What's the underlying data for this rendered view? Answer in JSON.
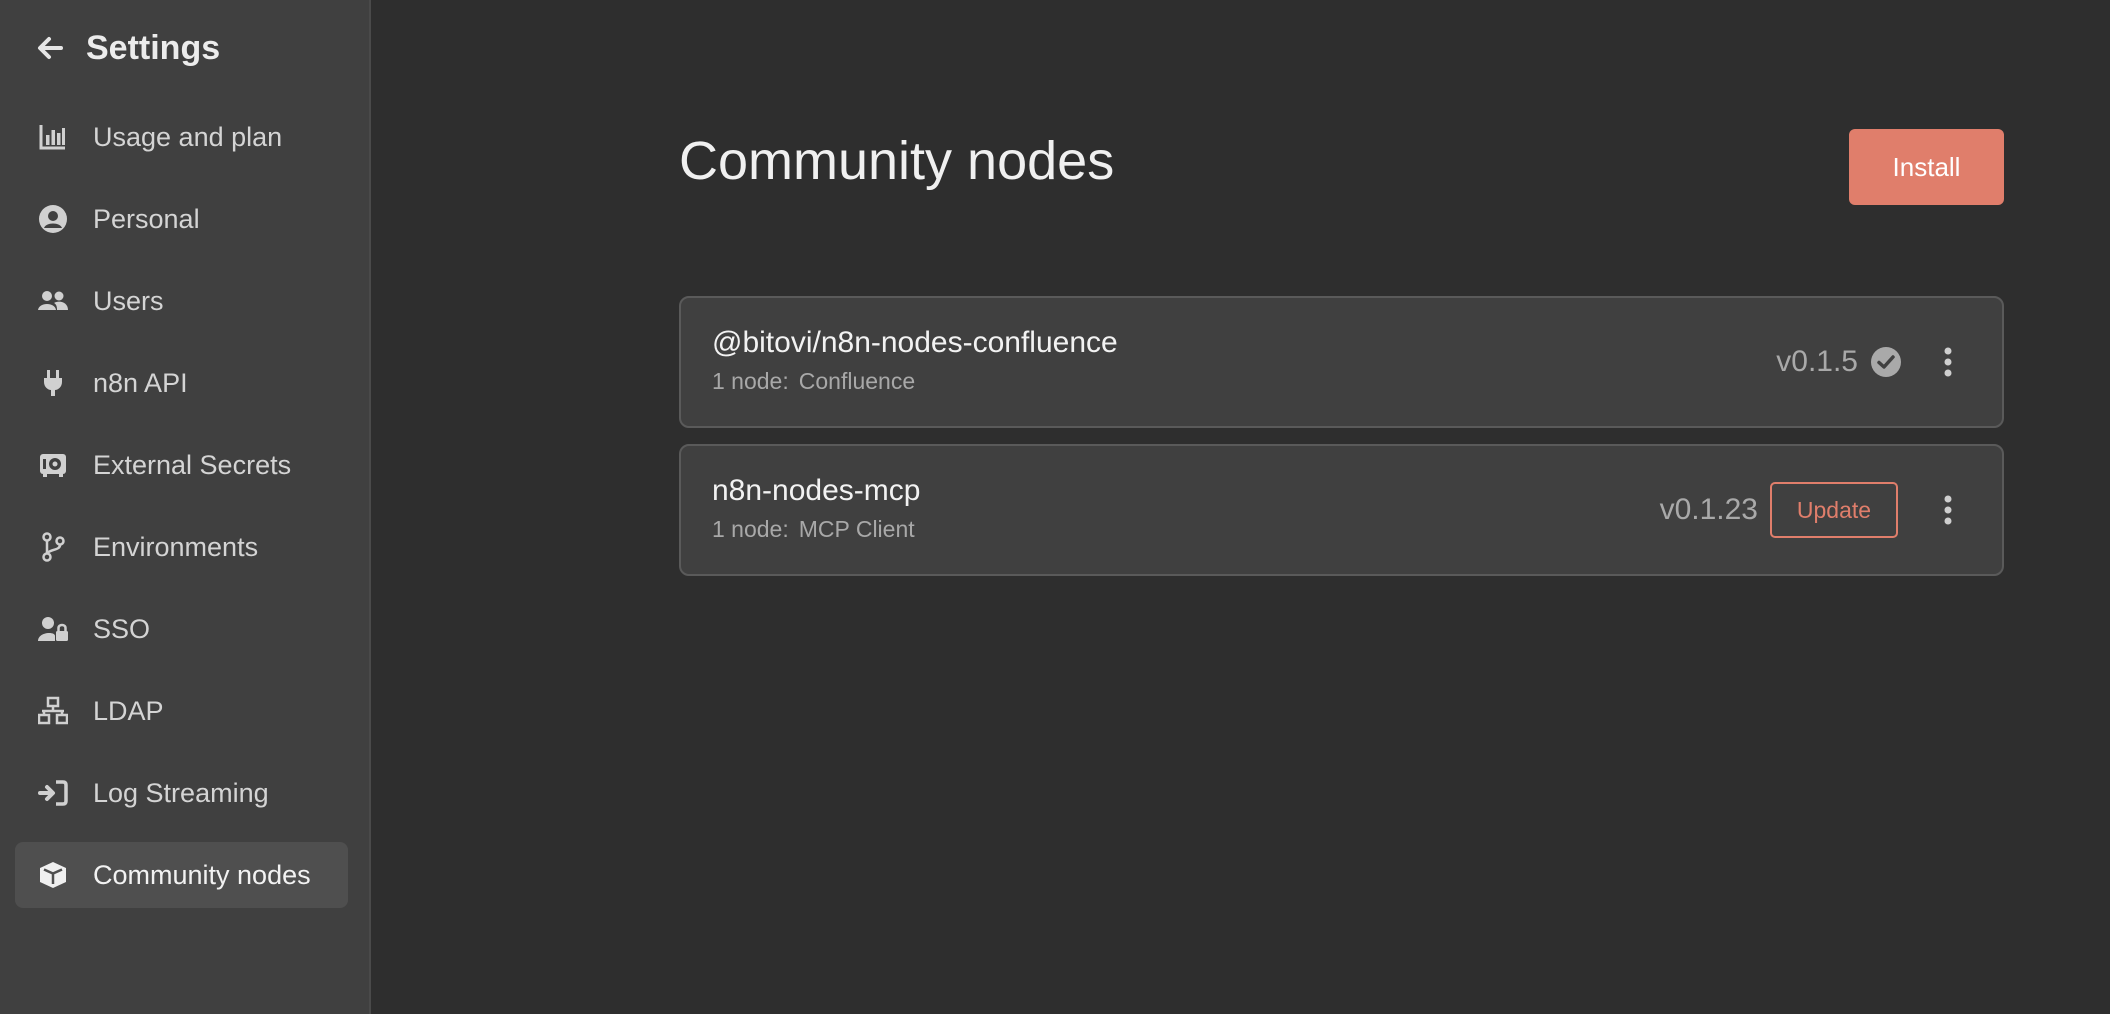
{
  "sidebar": {
    "title": "Settings",
    "items": [
      {
        "label": "Usage and plan",
        "icon": "chart-bar-icon",
        "active": false
      },
      {
        "label": "Personal",
        "icon": "user-circle-icon",
        "active": false
      },
      {
        "label": "Users",
        "icon": "users-icon",
        "active": false
      },
      {
        "label": "n8n API",
        "icon": "plug-icon",
        "active": false
      },
      {
        "label": "External Secrets",
        "icon": "vault-icon",
        "active": false
      },
      {
        "label": "Environments",
        "icon": "code-branch-icon",
        "active": false
      },
      {
        "label": "SSO",
        "icon": "user-lock-icon",
        "active": false
      },
      {
        "label": "LDAP",
        "icon": "network-wired-icon",
        "active": false
      },
      {
        "label": "Log Streaming",
        "icon": "sign-in-icon",
        "active": false
      },
      {
        "label": "Community nodes",
        "icon": "cube-icon",
        "active": true
      }
    ]
  },
  "main": {
    "title": "Community nodes",
    "install_label": "Install",
    "packages": [
      {
        "name": "@bitovi/n8n-nodes-confluence",
        "count_label": "1 node:",
        "node_name": "Confluence",
        "version": "v0.1.5",
        "status": "up-to-date"
      },
      {
        "name": "n8n-nodes-mcp",
        "count_label": "1 node:",
        "node_name": "MCP Client",
        "version": "v0.1.23",
        "update_label": "Update"
      }
    ]
  },
  "colors": {
    "accent": "#e07e6b",
    "sidebar_bg": "#404040",
    "main_bg": "#2e2e2e",
    "card_bg": "#404040"
  }
}
